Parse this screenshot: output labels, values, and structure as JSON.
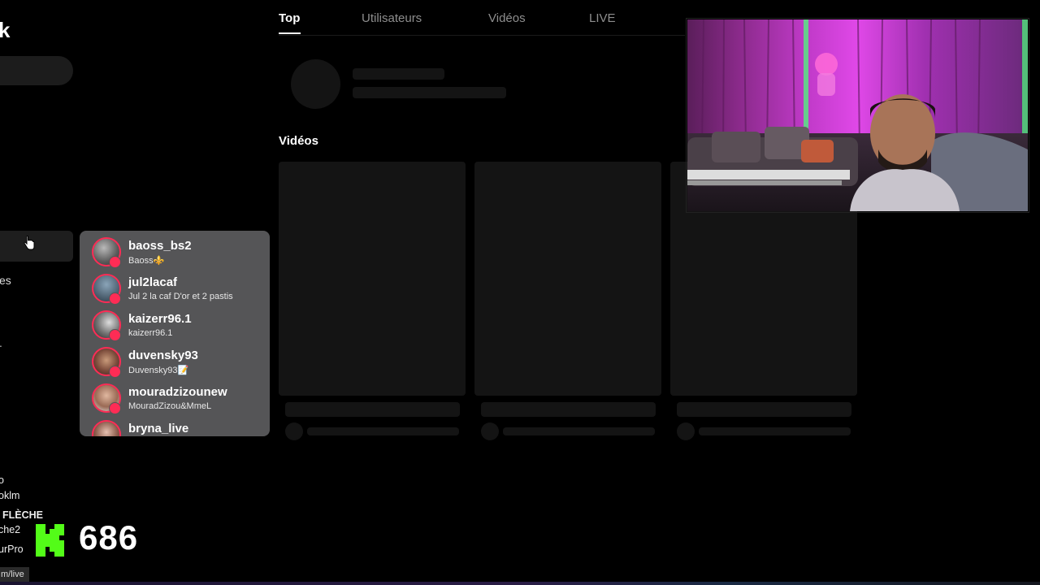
{
  "sidebar": {
    "logo_fragment": "k",
    "frag_1": "es",
    "frag_2": "."
  },
  "tabs": [
    {
      "label": "Top",
      "active": true
    },
    {
      "label": "Utilisateurs",
      "active": false
    },
    {
      "label": "Vidéos",
      "active": false
    },
    {
      "label": "LIVE",
      "active": false
    }
  ],
  "videos_section": {
    "title": "Vidéos"
  },
  "following_dropdown": {
    "items": [
      {
        "username": "baoss_bs2",
        "display": "Baoss⚜️"
      },
      {
        "username": "jul2lacaf",
        "display": "Jul 2 la caf D'or et 2 pastis"
      },
      {
        "username": "kaizerr96.1",
        "display": "kaizerr96.1"
      },
      {
        "username": "duvensky93",
        "display": "Duvensky93📝"
      },
      {
        "username": "mouradzizounew",
        "display": "MouradZizou&MmeL"
      },
      {
        "username": "bryna_live",
        "display": ""
      }
    ]
  },
  "overlay": {
    "chat_fragments": [
      "o",
      "oklm",
      "FLÈCHE",
      "che2",
      "urPro"
    ],
    "kick_counter": "686",
    "url_fragment": "m/live"
  },
  "colors": {
    "accent_live": "#fe2c55",
    "kick_green": "#53fc18",
    "dropdown_bg": "#555557"
  }
}
